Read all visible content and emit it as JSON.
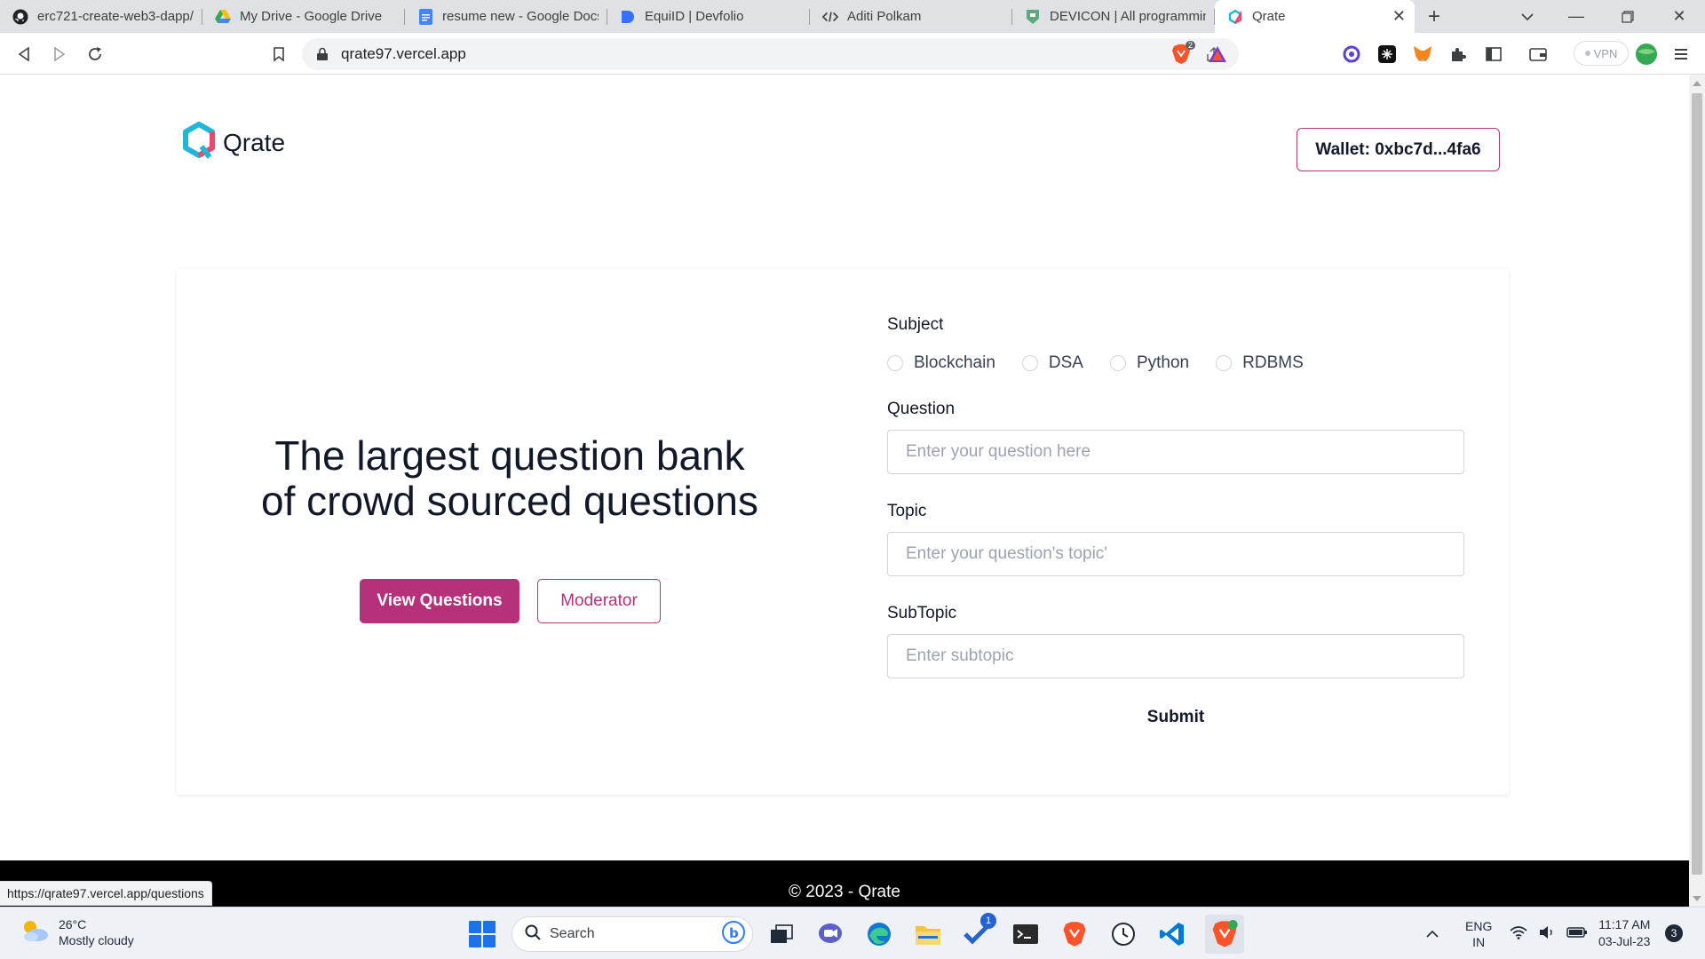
{
  "browser": {
    "tabs": [
      {
        "title": "erc721-create-web3-dapp/",
        "icon": "github-icon"
      },
      {
        "title": "My Drive - Google Drive",
        "icon": "google-drive-icon"
      },
      {
        "title": "resume new - Google Docs",
        "icon": "google-docs-icon"
      },
      {
        "title": "EquiID | Devfolio",
        "icon": "devfolio-icon"
      },
      {
        "title": "Aditi Polkam",
        "icon": "code-icon"
      },
      {
        "title": "DEVICON | All programmin",
        "icon": "devicon-icon"
      },
      {
        "title": "Qrate",
        "icon": "qrate-icon",
        "active": true
      }
    ],
    "url": "qrate97.vercel.app",
    "brave_badge": "2",
    "vpn_label": "VPN",
    "status_url": "https://qrate97.vercel.app/questions"
  },
  "header": {
    "logo_text": "Qrate",
    "wallet_label": "Wallet: 0xbc7d...4fa6"
  },
  "hero": {
    "line1": "The largest question bank",
    "line2": "of crowd sourced questions",
    "view_questions": "View Questions",
    "moderator": "Moderator"
  },
  "form": {
    "subject_label": "Subject",
    "subjects": [
      "Blockchain",
      "DSA",
      "Python",
      "RDBMS"
    ],
    "question_label": "Question",
    "question_placeholder": "Enter your question here",
    "topic_label": "Topic",
    "topic_placeholder": "Enter your question's topic'",
    "subtopic_label": "SubTopic",
    "subtopic_placeholder": "Enter subtopic",
    "submit_label": "Submit"
  },
  "footer": {
    "text": "© 2023 - Qrate"
  },
  "taskbar": {
    "temperature": "26°C",
    "weather": "Mostly cloudy",
    "search_label": "Search",
    "lang1": "ENG",
    "lang2": "IN",
    "time": "11:17 AM",
    "date": "03-Jul-23",
    "notifications": "3",
    "todo_badge": "1"
  },
  "colors": {
    "accent": "#b5317a",
    "footer_bg": "#000000"
  }
}
